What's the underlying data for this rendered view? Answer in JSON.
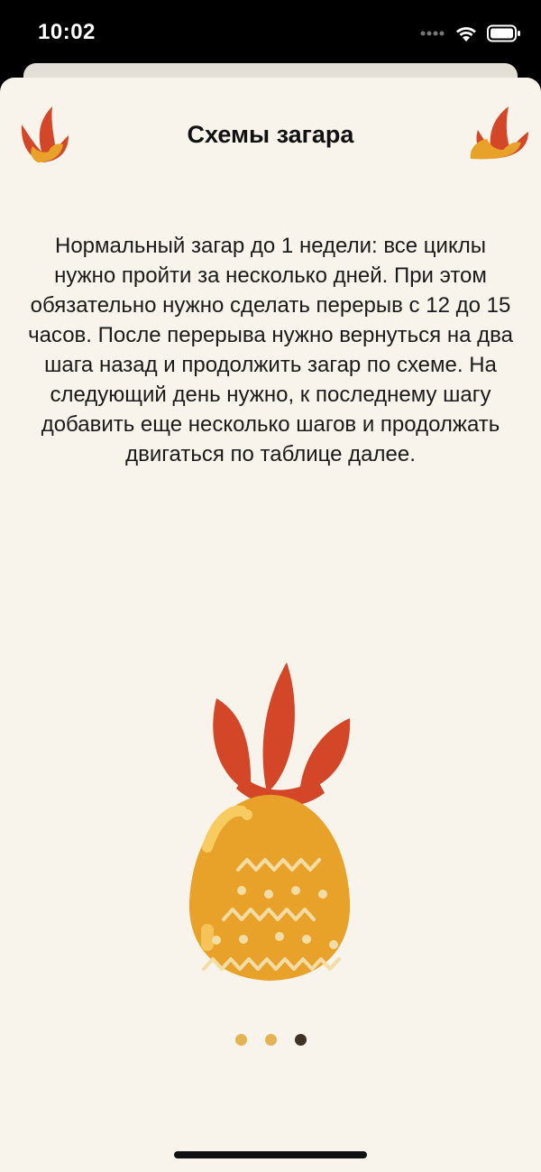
{
  "status_bar": {
    "time": "10:02"
  },
  "header": {
    "title": "Схемы загара"
  },
  "content": {
    "text": "Нормальный загар до 1 недели: все циклы нужно пройти за несколько дней. При этом обязательно нужно сделать перерыв с 12 до 15 часов. После перерыва нужно вернуться на два шага назад и продолжить загар по схеме. На следующий день нужно, к последнему шагу добавить еще несколько шагов и продолжать двигаться по таблице далее."
  },
  "pagination": {
    "total": 3,
    "active_index": 2
  },
  "colors": {
    "sheet_background": "#f8f4ec",
    "flame_red": "#d34628",
    "pineapple_orange": "#e9a229",
    "dot_inactive": "#e4b354",
    "dot_active": "#3e3325"
  },
  "icons": [
    "flame-icon",
    "wifi-icon",
    "battery-icon",
    "pineapple-illustration"
  ]
}
